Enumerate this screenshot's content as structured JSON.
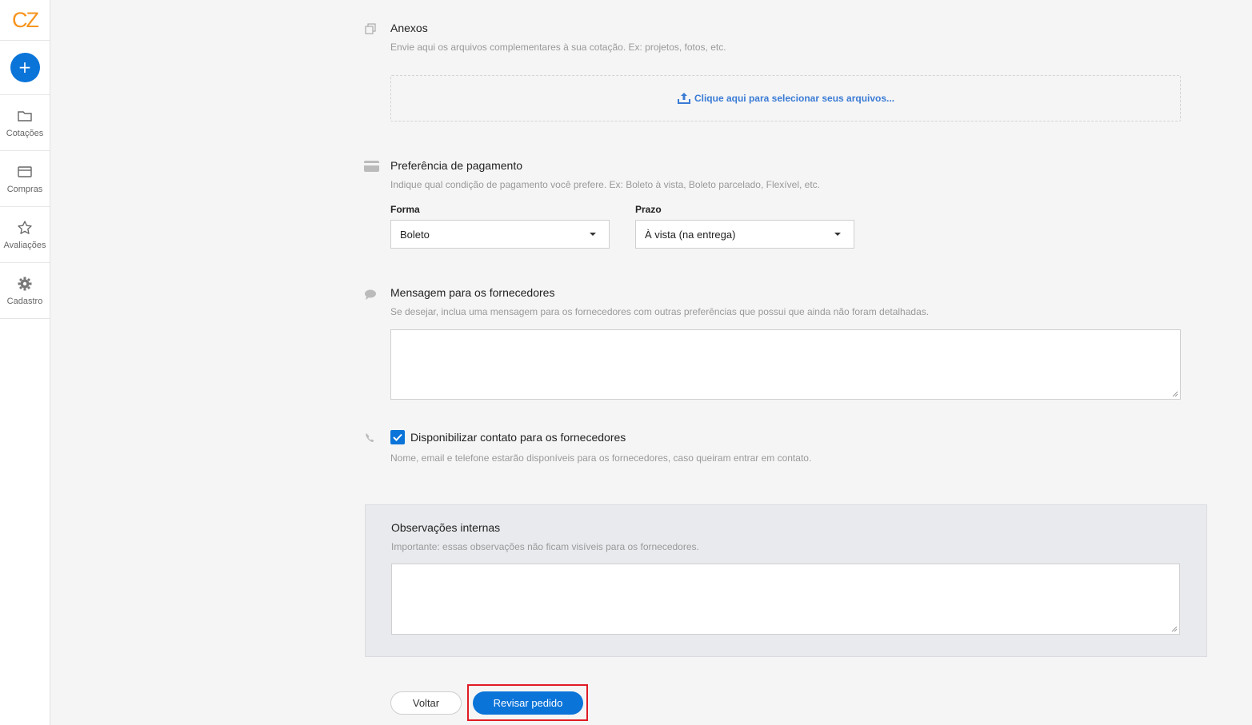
{
  "sidebar": {
    "logo": "CZ",
    "new_button": "+",
    "items": [
      {
        "label": "Cotações",
        "icon": "folder-icon"
      },
      {
        "label": "Compras",
        "icon": "card-icon"
      },
      {
        "label": "Avaliações",
        "icon": "star-icon"
      },
      {
        "label": "Cadastro",
        "icon": "gear-icon"
      }
    ]
  },
  "attachments": {
    "title": "Anexos",
    "description": "Envie aqui os arquivos complementares à sua cotação. Ex: projetos, fotos, etc.",
    "upload_label": "Clique aqui para selecionar seus arquivos..."
  },
  "payment": {
    "title": "Preferência de pagamento",
    "description": "Indique qual condição de pagamento você prefere. Ex: Boleto à vista, Boleto parcelado, Flexível, etc.",
    "method_label": "Forma",
    "method_value": "Boleto",
    "term_label": "Prazo",
    "term_value": "À vista (na entrega)"
  },
  "message": {
    "title": "Mensagem para os fornecedores",
    "description": "Se desejar, inclua uma mensagem para os fornecedores com outras preferências que possui que ainda não foram detalhadas."
  },
  "contact": {
    "label": "Disponibilizar contato para os fornecedores",
    "description": "Nome, email e telefone estarão disponíveis para os fornecedores, caso queiram entrar em contato."
  },
  "internal_notes": {
    "title": "Observações internas",
    "description": "Importante: essas observações não ficam visíveis para os fornecedores."
  },
  "actions": {
    "back_label": "Voltar",
    "review_label": "Revisar pedido"
  },
  "colors": {
    "brand": "#f7941d",
    "primary": "#0a74d9",
    "highlight": "#e01b24"
  }
}
